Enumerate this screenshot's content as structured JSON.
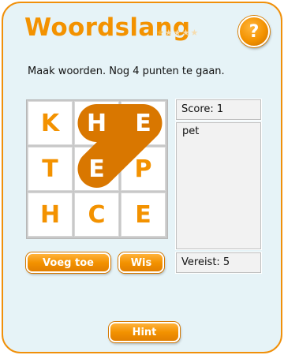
{
  "title": "Woordslang",
  "stars": {
    "filled": 1,
    "total": 5
  },
  "help_button": {
    "label": "?"
  },
  "instruction": "Maak woorden. Nog 4 punten te gaan.",
  "grid": [
    [
      "K",
      "H",
      "E"
    ],
    [
      "T",
      "E",
      "P"
    ],
    [
      "H",
      "C",
      "E"
    ]
  ],
  "selected_path": [
    [
      0,
      1
    ],
    [
      0,
      2
    ],
    [
      1,
      1
    ]
  ],
  "score": "Score: 1",
  "found_words": [
    "pet"
  ],
  "required": "Vereist: 5",
  "buttons": {
    "add": "Voeg toe",
    "clear": "Wis",
    "hint": "Hint"
  },
  "colors": {
    "accent": "#f39200",
    "path": "#d97700",
    "background": "#e6f3f7"
  }
}
